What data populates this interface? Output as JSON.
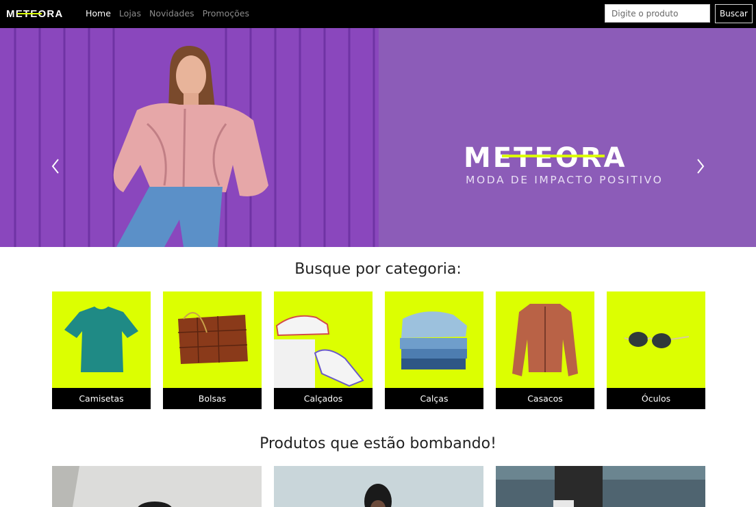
{
  "brand": {
    "name": "METEORA"
  },
  "nav": {
    "links": [
      "Home",
      "Lojas",
      "Novidades",
      "Promoções"
    ],
    "active_index": 0
  },
  "search": {
    "placeholder": "Digite o produto",
    "button_label": "Buscar"
  },
  "hero": {
    "brand": "METEORA",
    "tagline": "MODA DE IMPACTO POSITIVO",
    "slide_count": 3,
    "active_slide": 0
  },
  "categories": {
    "title": "Busque por categoria:",
    "items": [
      "Camisetas",
      "Bolsas",
      "Calçados",
      "Calças",
      "Casacos",
      "Óculos"
    ]
  },
  "products": {
    "title": "Produtos que estão bombando!"
  },
  "colors": {
    "nav_bg": "#000000",
    "hero_bg": "#8c5cb8",
    "accent_lime": "#dcff01",
    "label_bg": "#000000"
  }
}
